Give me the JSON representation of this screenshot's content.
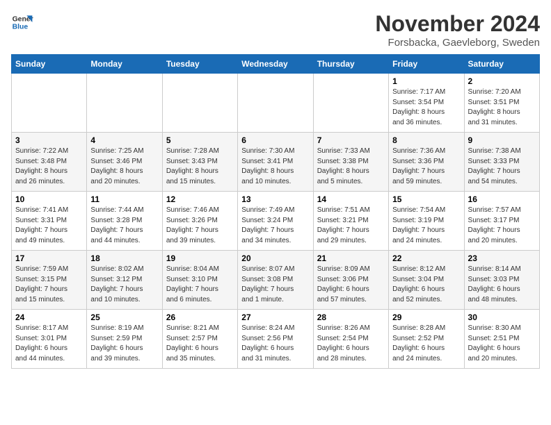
{
  "header": {
    "logo_line1": "General",
    "logo_line2": "Blue",
    "title": "November 2024",
    "subtitle": "Forsbacka, Gaevleborg, Sweden"
  },
  "weekdays": [
    "Sunday",
    "Monday",
    "Tuesday",
    "Wednesday",
    "Thursday",
    "Friday",
    "Saturday"
  ],
  "weeks": [
    [
      {
        "day": "",
        "info": ""
      },
      {
        "day": "",
        "info": ""
      },
      {
        "day": "",
        "info": ""
      },
      {
        "day": "",
        "info": ""
      },
      {
        "day": "",
        "info": ""
      },
      {
        "day": "1",
        "info": "Sunrise: 7:17 AM\nSunset: 3:54 PM\nDaylight: 8 hours\nand 36 minutes."
      },
      {
        "day": "2",
        "info": "Sunrise: 7:20 AM\nSunset: 3:51 PM\nDaylight: 8 hours\nand 31 minutes."
      }
    ],
    [
      {
        "day": "3",
        "info": "Sunrise: 7:22 AM\nSunset: 3:48 PM\nDaylight: 8 hours\nand 26 minutes."
      },
      {
        "day": "4",
        "info": "Sunrise: 7:25 AM\nSunset: 3:46 PM\nDaylight: 8 hours\nand 20 minutes."
      },
      {
        "day": "5",
        "info": "Sunrise: 7:28 AM\nSunset: 3:43 PM\nDaylight: 8 hours\nand 15 minutes."
      },
      {
        "day": "6",
        "info": "Sunrise: 7:30 AM\nSunset: 3:41 PM\nDaylight: 8 hours\nand 10 minutes."
      },
      {
        "day": "7",
        "info": "Sunrise: 7:33 AM\nSunset: 3:38 PM\nDaylight: 8 hours\nand 5 minutes."
      },
      {
        "day": "8",
        "info": "Sunrise: 7:36 AM\nSunset: 3:36 PM\nDaylight: 7 hours\nand 59 minutes."
      },
      {
        "day": "9",
        "info": "Sunrise: 7:38 AM\nSunset: 3:33 PM\nDaylight: 7 hours\nand 54 minutes."
      }
    ],
    [
      {
        "day": "10",
        "info": "Sunrise: 7:41 AM\nSunset: 3:31 PM\nDaylight: 7 hours\nand 49 minutes."
      },
      {
        "day": "11",
        "info": "Sunrise: 7:44 AM\nSunset: 3:28 PM\nDaylight: 7 hours\nand 44 minutes."
      },
      {
        "day": "12",
        "info": "Sunrise: 7:46 AM\nSunset: 3:26 PM\nDaylight: 7 hours\nand 39 minutes."
      },
      {
        "day": "13",
        "info": "Sunrise: 7:49 AM\nSunset: 3:24 PM\nDaylight: 7 hours\nand 34 minutes."
      },
      {
        "day": "14",
        "info": "Sunrise: 7:51 AM\nSunset: 3:21 PM\nDaylight: 7 hours\nand 29 minutes."
      },
      {
        "day": "15",
        "info": "Sunrise: 7:54 AM\nSunset: 3:19 PM\nDaylight: 7 hours\nand 24 minutes."
      },
      {
        "day": "16",
        "info": "Sunrise: 7:57 AM\nSunset: 3:17 PM\nDaylight: 7 hours\nand 20 minutes."
      }
    ],
    [
      {
        "day": "17",
        "info": "Sunrise: 7:59 AM\nSunset: 3:15 PM\nDaylight: 7 hours\nand 15 minutes."
      },
      {
        "day": "18",
        "info": "Sunrise: 8:02 AM\nSunset: 3:12 PM\nDaylight: 7 hours\nand 10 minutes."
      },
      {
        "day": "19",
        "info": "Sunrise: 8:04 AM\nSunset: 3:10 PM\nDaylight: 7 hours\nand 6 minutes."
      },
      {
        "day": "20",
        "info": "Sunrise: 8:07 AM\nSunset: 3:08 PM\nDaylight: 7 hours\nand 1 minute."
      },
      {
        "day": "21",
        "info": "Sunrise: 8:09 AM\nSunset: 3:06 PM\nDaylight: 6 hours\nand 57 minutes."
      },
      {
        "day": "22",
        "info": "Sunrise: 8:12 AM\nSunset: 3:04 PM\nDaylight: 6 hours\nand 52 minutes."
      },
      {
        "day": "23",
        "info": "Sunrise: 8:14 AM\nSunset: 3:03 PM\nDaylight: 6 hours\nand 48 minutes."
      }
    ],
    [
      {
        "day": "24",
        "info": "Sunrise: 8:17 AM\nSunset: 3:01 PM\nDaylight: 6 hours\nand 44 minutes."
      },
      {
        "day": "25",
        "info": "Sunrise: 8:19 AM\nSunset: 2:59 PM\nDaylight: 6 hours\nand 39 minutes."
      },
      {
        "day": "26",
        "info": "Sunrise: 8:21 AM\nSunset: 2:57 PM\nDaylight: 6 hours\nand 35 minutes."
      },
      {
        "day": "27",
        "info": "Sunrise: 8:24 AM\nSunset: 2:56 PM\nDaylight: 6 hours\nand 31 minutes."
      },
      {
        "day": "28",
        "info": "Sunrise: 8:26 AM\nSunset: 2:54 PM\nDaylight: 6 hours\nand 28 minutes."
      },
      {
        "day": "29",
        "info": "Sunrise: 8:28 AM\nSunset: 2:52 PM\nDaylight: 6 hours\nand 24 minutes."
      },
      {
        "day": "30",
        "info": "Sunrise: 8:30 AM\nSunset: 2:51 PM\nDaylight: 6 hours\nand 20 minutes."
      }
    ]
  ]
}
